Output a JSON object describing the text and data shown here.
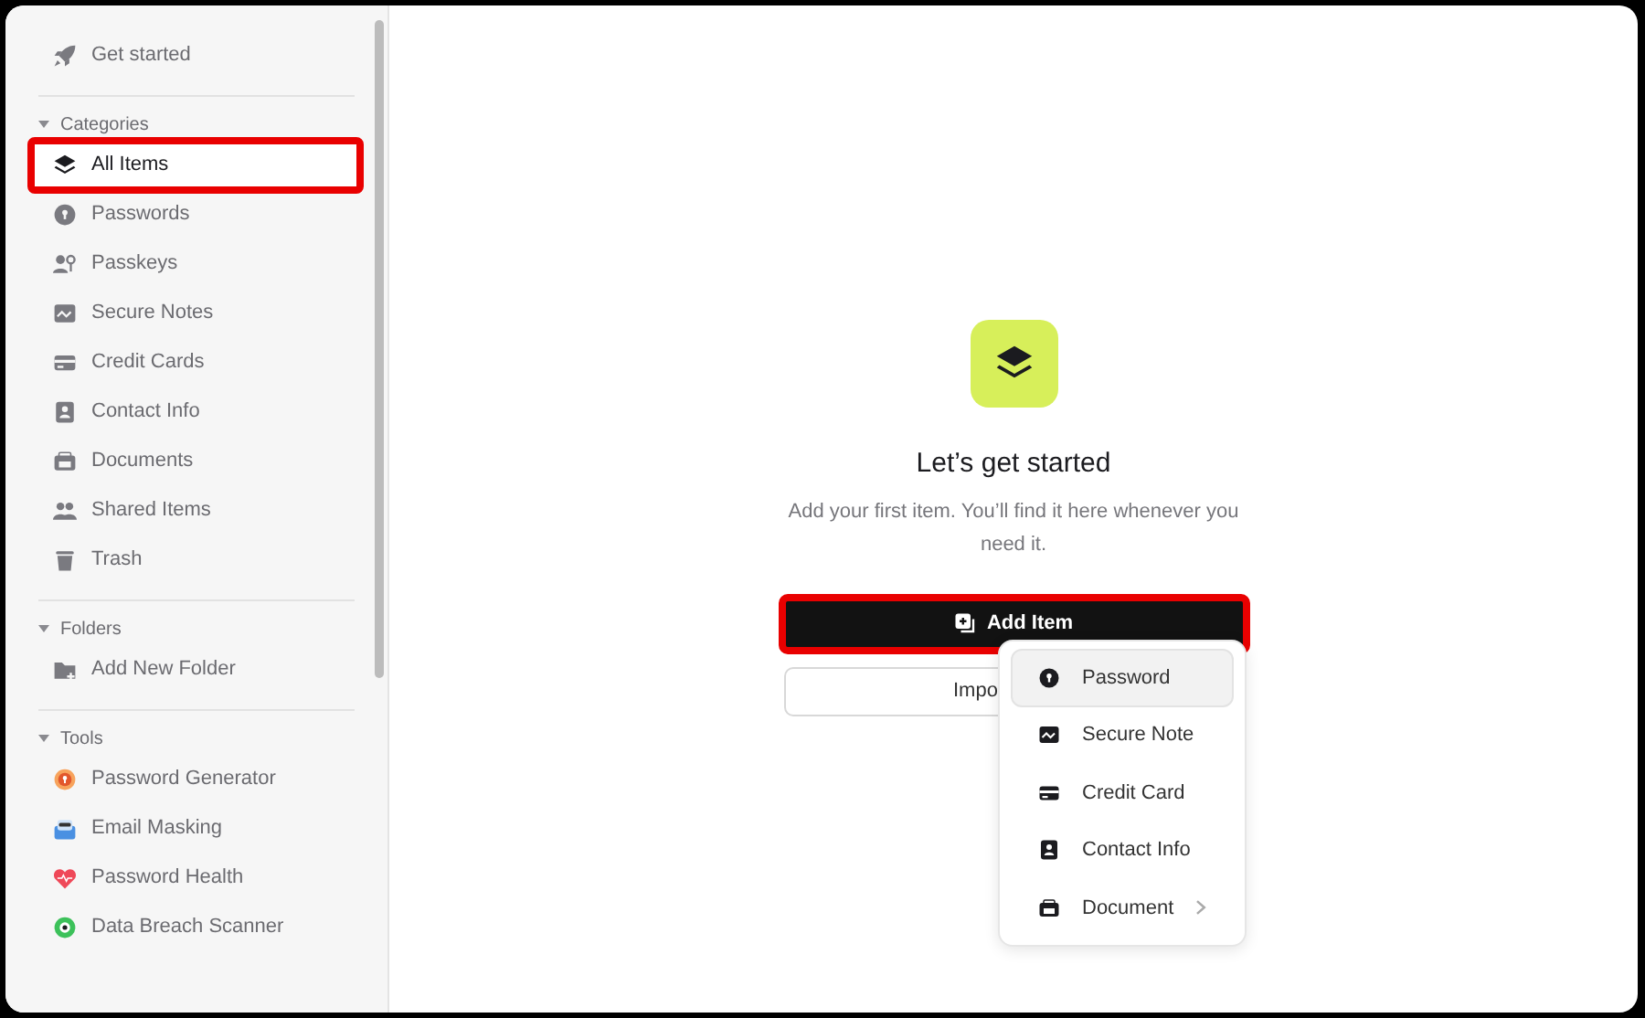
{
  "sidebar": {
    "get_started": "Get started",
    "sections": [
      {
        "title": "Categories",
        "expanded": true,
        "items": [
          {
            "label": "All Items",
            "selected": true,
            "highlighted": true
          },
          {
            "label": "Passwords",
            "selected": false,
            "highlighted": false
          },
          {
            "label": "Passkeys",
            "selected": false,
            "highlighted": false
          },
          {
            "label": "Secure Notes",
            "selected": false,
            "highlighted": false
          },
          {
            "label": "Credit Cards",
            "selected": false,
            "highlighted": false
          },
          {
            "label": "Contact Info",
            "selected": false,
            "highlighted": false
          },
          {
            "label": "Documents",
            "selected": false,
            "highlighted": false
          },
          {
            "label": "Shared Items",
            "selected": false,
            "highlighted": false
          },
          {
            "label": "Trash",
            "selected": false,
            "highlighted": false
          }
        ]
      },
      {
        "title": "Folders",
        "expanded": true,
        "items": [
          {
            "label": "Add New Folder",
            "selected": false,
            "highlighted": false
          }
        ]
      },
      {
        "title": "Tools",
        "expanded": true,
        "items": [
          {
            "label": "Password Generator",
            "selected": false,
            "highlighted": false
          },
          {
            "label": "Email Masking",
            "selected": false,
            "highlighted": false
          },
          {
            "label": "Password Health",
            "selected": false,
            "highlighted": false
          },
          {
            "label": "Data Breach Scanner",
            "selected": false,
            "highlighted": false
          }
        ]
      }
    ]
  },
  "empty_state": {
    "title": "Let’s get started",
    "subtitle": "Add your first item. You’ll find it here whenever you need it.",
    "add_button": {
      "label": "Add Item",
      "highlighted": true
    },
    "import_button": {
      "label": "Impo"
    }
  },
  "add_menu": [
    {
      "label": "Password",
      "selected": true,
      "submenu": false
    },
    {
      "label": "Secure Note",
      "selected": false,
      "submenu": false
    },
    {
      "label": "Credit Card",
      "selected": false,
      "submenu": false
    },
    {
      "label": "Contact Info",
      "selected": false,
      "submenu": false
    },
    {
      "label": "Document",
      "selected": false,
      "submenu": true
    }
  ]
}
